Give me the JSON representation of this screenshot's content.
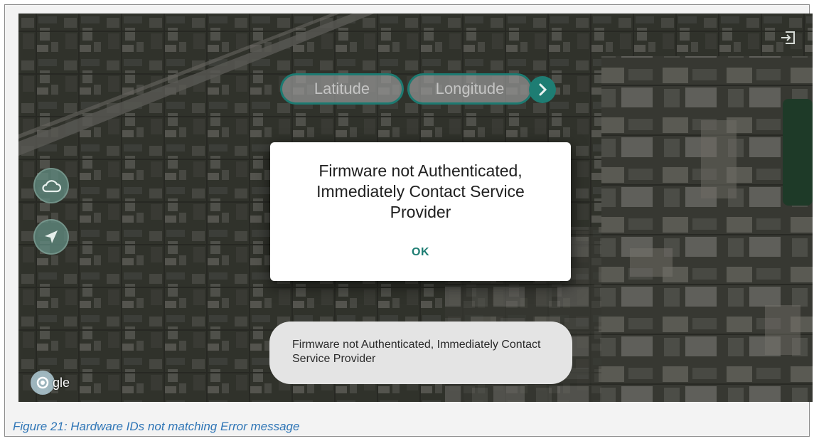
{
  "search": {
    "latitude_placeholder": "Latitude",
    "longitude_placeholder": "Longitude",
    "go_icon": "chevron-right-icon"
  },
  "side_buttons": [
    {
      "icon": "cloud-icon"
    },
    {
      "icon": "navigation-arrow-icon"
    }
  ],
  "top_right": {
    "icon": "exit-icon"
  },
  "dialog": {
    "message": "Firmware not Authenticated, Immediately Contact Service Provider",
    "ok_label": "OK"
  },
  "toast": {
    "message": "Firmware not Authenticated, Immediately Contact Service Provider"
  },
  "map_attribution": {
    "text": "gle"
  },
  "caption": "Figure 21: Hardware IDs not matching Error message",
  "colors": {
    "accent": "#1e7d73",
    "caption": "#2e75b6"
  }
}
